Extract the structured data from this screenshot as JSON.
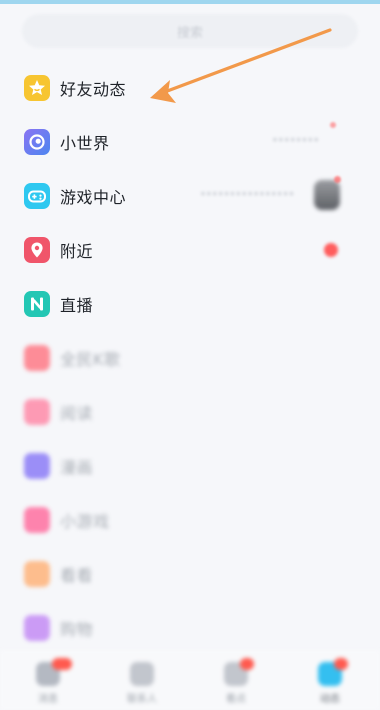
{
  "search": {
    "placeholder": "搜索"
  },
  "menu": {
    "friends_feed": {
      "label": "好友动态",
      "icon": "star-icon",
      "color": "#f7c531"
    },
    "small_world": {
      "label": "小世界",
      "icon": "swirl-icon",
      "color": "#6a7cf0"
    },
    "game_center": {
      "label": "游戏中心",
      "icon": "gamepad-icon",
      "color": "#2ec8f0"
    },
    "nearby": {
      "label": "附近",
      "icon": "location-pin-icon",
      "color": "#f0556a"
    },
    "live": {
      "label": "直播",
      "icon": "live-icon",
      "color": "#23c7b4"
    }
  },
  "blurred_items": [
    {
      "label": "全民K歌",
      "color": "#ff7a86"
    },
    {
      "label": "阅读",
      "color": "#ff8aa8"
    },
    {
      "label": "漫画",
      "color": "#8c7cf7"
    },
    {
      "label": "小游戏",
      "color": "#ff6fa0"
    },
    {
      "label": "看看",
      "color": "#ffb37a"
    },
    {
      "label": "购物",
      "color": "#c48cf5"
    }
  ],
  "tabbar": [
    {
      "label": "消息"
    },
    {
      "label": "联系人"
    },
    {
      "label": "看点"
    },
    {
      "label": "动态"
    }
  ],
  "colors": {
    "arrow": "#f2994a",
    "badge": "#ff5d5d"
  }
}
